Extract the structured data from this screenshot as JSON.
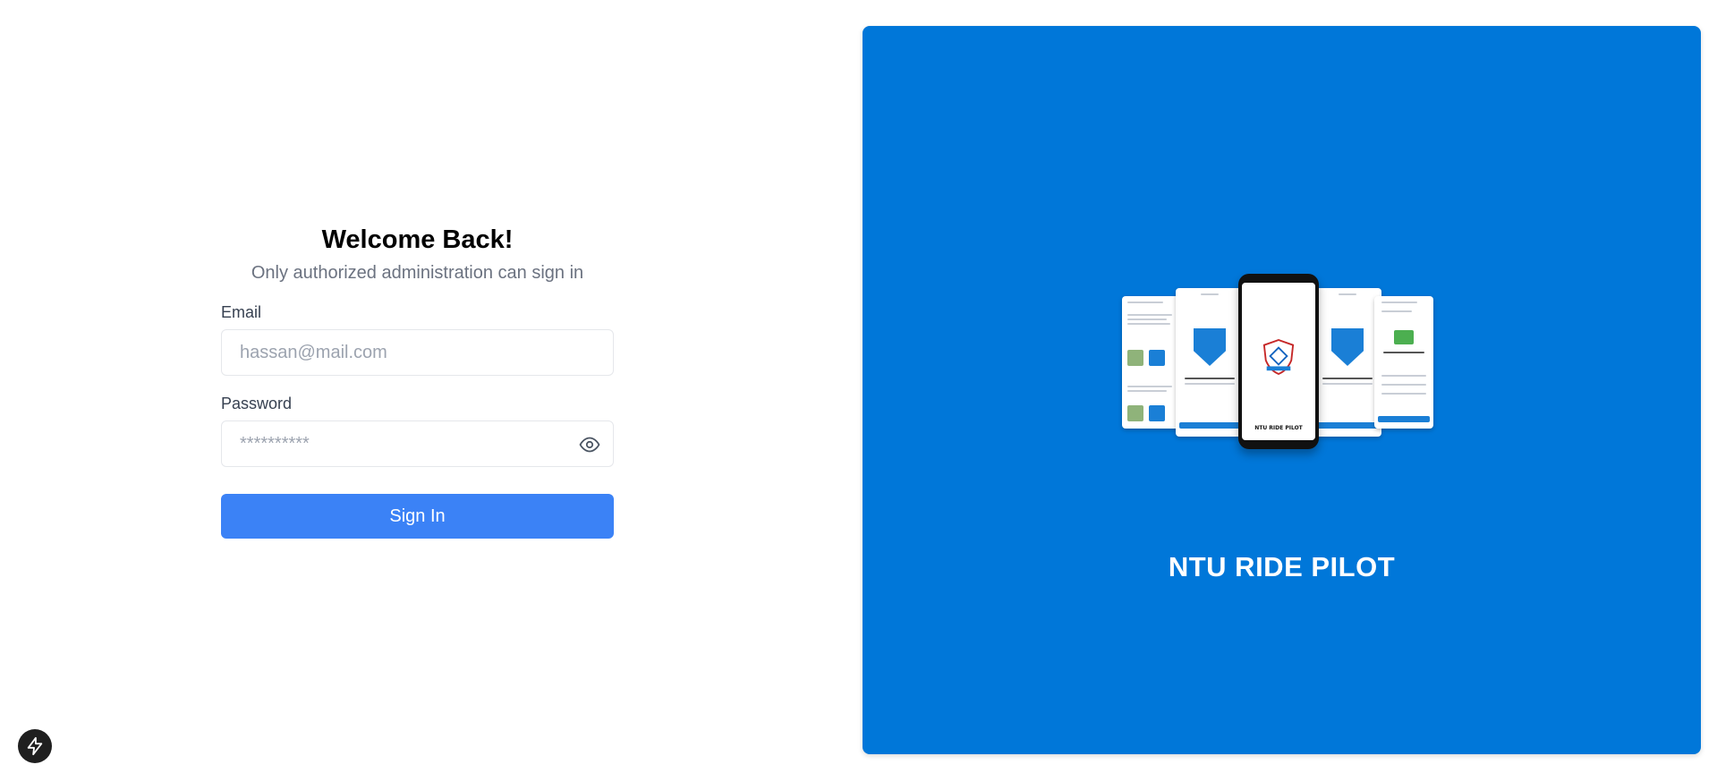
{
  "login": {
    "title": "Welcome Back!",
    "subtitle": "Only authorized administration can sign in",
    "email_label": "Email",
    "email_placeholder": "hassan@mail.com",
    "email_value": "",
    "password_label": "Password",
    "password_placeholder": "**********",
    "password_value": "",
    "signin_label": "Sign In",
    "show_password_icon": "eye-icon"
  },
  "brand_panel": {
    "title": "NTU RIDE PILOT",
    "background_color": "#0077d9",
    "image": "app-screens-mockup",
    "phone_label": "NTU RIDE PILOT"
  },
  "dev_tools": {
    "icon": "lightning-bolt-icon"
  },
  "colors": {
    "primary_button": "#3b82f6",
    "panel": "#0077d9"
  }
}
